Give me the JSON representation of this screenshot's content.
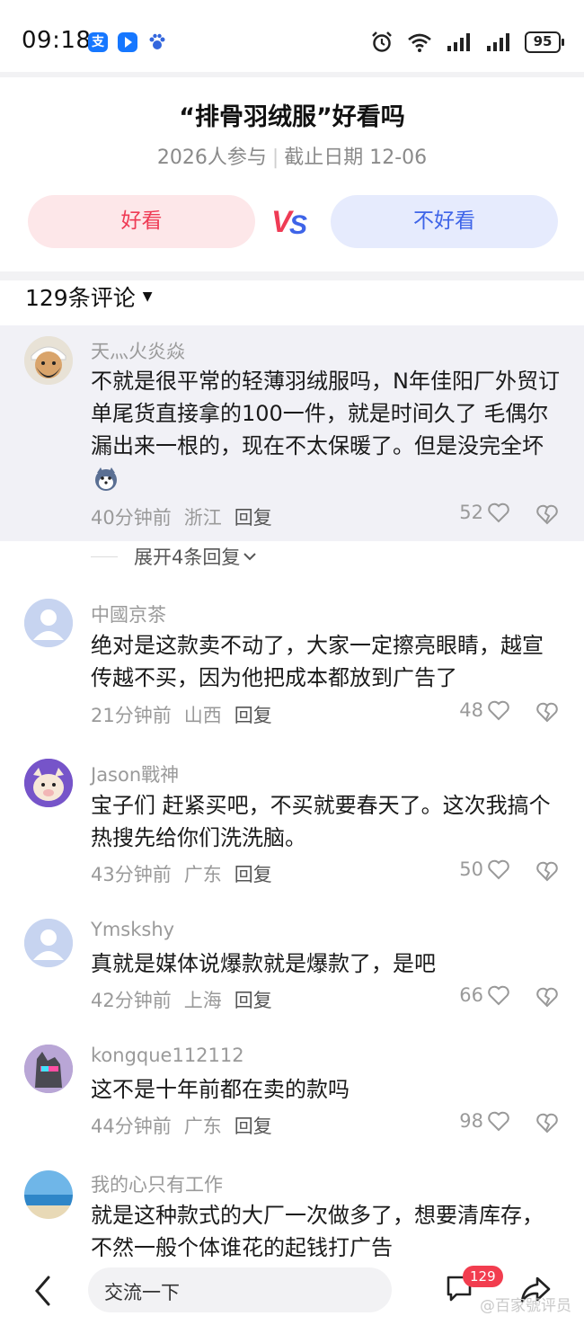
{
  "status_bar": {
    "time": "09:18",
    "battery": "95",
    "app_icons": [
      "alipay-icon",
      "send-icon",
      "baidu-paw-icon"
    ]
  },
  "poll": {
    "title": "“排骨羽绒服”好看吗",
    "participants": "2026人参与",
    "deadline": "截止日期 12-06",
    "option_good": "好看",
    "option_bad": "不好看",
    "vs_label": "VS"
  },
  "comments_header": {
    "label": "129条评论"
  },
  "comments": [
    {
      "username": "天灬火炎焱",
      "text": "不就是很平常的轻薄羽绒服吗，N年佳阳厂外贸订单尾货直接拿的100一件，就是时间久了 毛偶尔漏出来一根的，现在不太保暖了。但是没完全坏",
      "time": "40分钟前",
      "location": "浙江",
      "reply": "回复",
      "likes": "52",
      "expand": "展开4条回复"
    },
    {
      "username": "中國京茶",
      "text": "绝对是这款卖不动了，大家一定擦亮眼睛，越宣传越不买，因为他把成本都放到广告了",
      "time": "21分钟前",
      "location": "山西",
      "reply": "回复",
      "likes": "48"
    },
    {
      "username": "Jason戰神",
      "text": "宝子们 赶紧买吧，不买就要春天了。这次我搞个热搜先给你们洗洗脑。",
      "time": "43分钟前",
      "location": "广东",
      "reply": "回复",
      "likes": "50"
    },
    {
      "username": "Ymskshy",
      "text": "真就是媒体说爆款就是爆款了，是吧",
      "time": "42分钟前",
      "location": "上海",
      "reply": "回复",
      "likes": "66"
    },
    {
      "username": "kongque112112",
      "text": "这不是十年前都在卖的款吗",
      "time": "44分钟前",
      "location": "广东",
      "reply": "回复",
      "likes": "98"
    },
    {
      "username": "我的心只有工作",
      "text": "就是这种款式的大厂一次做多了，想要清库存，不然一般个体谁花的起钱打广告"
    }
  ],
  "bottom_bar": {
    "input_placeholder": "交流一下",
    "comment_count": "129",
    "watermark": "@百家號评员"
  },
  "colors": {
    "good": "#ef3b55",
    "bad": "#3e64e8",
    "badge": "#f23d4f"
  }
}
